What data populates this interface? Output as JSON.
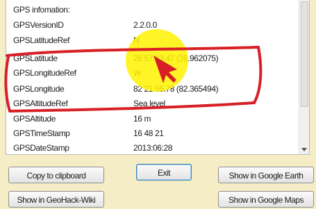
{
  "properties": [
    {
      "name": "GPS infomation:",
      "value": ""
    },
    {
      "name": "GPSVersionID",
      "value": "2.2.0.0"
    },
    {
      "name": "GPSLatitudeRef",
      "value": "N"
    },
    {
      "name": "GPSLatitude",
      "value": "26  57  43.47 (26.962075)"
    },
    {
      "name": "GPSLongitudeRef",
      "value": "W"
    },
    {
      "name": "GPSLongitude",
      "value": "82  21  55.78 (82.365494)"
    },
    {
      "name": "GPSAltitudeRef",
      "value": "Sea level"
    },
    {
      "name": "GPSAltitude",
      "value": "16 m"
    },
    {
      "name": "GPSTimeStamp",
      "value": "16  48  21"
    },
    {
      "name": "GPSDateStamp",
      "value": "2013:06:28"
    }
  ],
  "buttons": {
    "copy": "Copy to clipboard",
    "exit": "Exit",
    "google_earth": "Show in Google Earth",
    "geohack": "Show in GeoHack-Wiki",
    "google_maps": "Show in Google Maps"
  },
  "colors": {
    "background": "#f5edc6",
    "highlight": "#fff200",
    "annotation": "#d81f26"
  }
}
